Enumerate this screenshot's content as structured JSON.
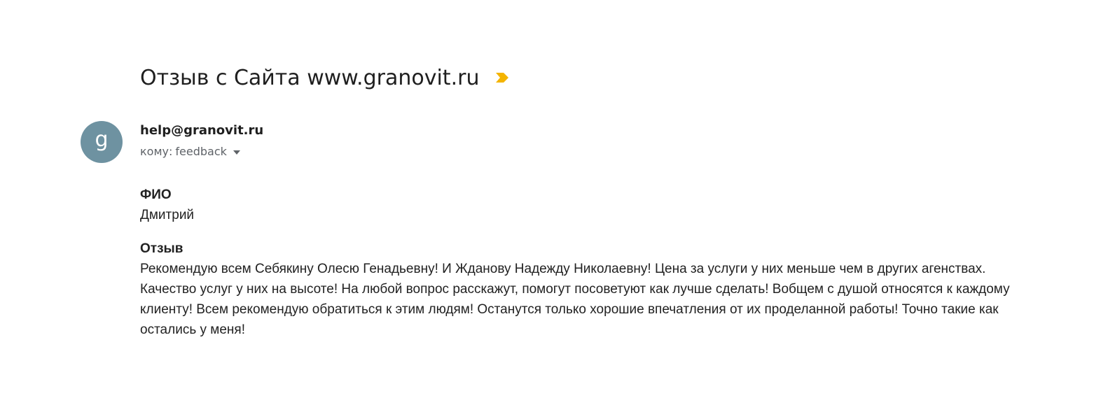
{
  "email": {
    "subject": "Отзыв с Сайта www.granovit.ru",
    "importance_icon": "importance-marker-icon",
    "importance_color": "#f4b400",
    "avatar": {
      "letter": "g",
      "color": "#6e92a1"
    },
    "sender": "help@granovit.ru",
    "recipient_prefix": "кому:",
    "recipient": "feedback",
    "recipient_details_icon": "chevron-down-icon",
    "fields": [
      {
        "label": "ФИО",
        "value": "Дмитрий"
      },
      {
        "label": "Отзыв",
        "value": "Рекомендую всем Себякину Олесю Генадьевну! И Жданову Надежду Николаевну! Цена за услуги у них меньше чем в других агенствах. Качество услуг у них на высоте! На любой вопрос расскажут, помогут посоветуют как лучше сделать! Вобщем с душой относятся к каждому клиенту! Всем рекомендую обратиться к этим людям! Останутся только хорошие впечатления от их проделанной работы! Точно такие как остались у меня!"
      }
    ]
  }
}
